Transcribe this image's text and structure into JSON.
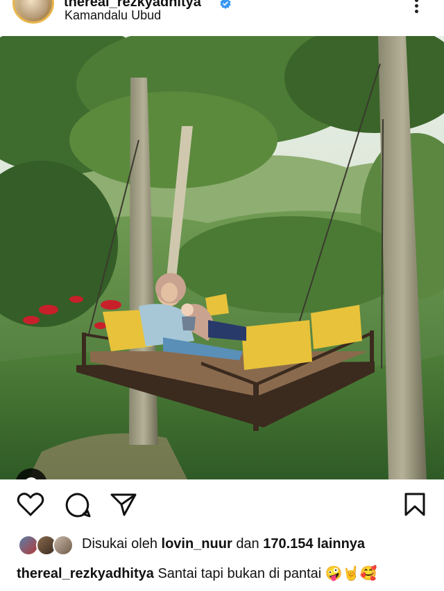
{
  "post": {
    "username": "thereal_rezkyadhitya",
    "location": "Kamandalu Ubud",
    "icons": {
      "verified": "verified-badge-icon",
      "more": "more-options-icon",
      "tag": "tagged-user-icon",
      "like": "heart-icon",
      "comment": "comment-icon",
      "share": "share-icon",
      "save": "bookmark-icon"
    }
  },
  "likes": {
    "prefix": "Disukai oleh",
    "user": "lovin_nuur",
    "connector": "dan",
    "count": "170.154",
    "suffix": "lainnya"
  },
  "caption": {
    "username": "thereal_rezkyadhitya",
    "text": "Santai tapi bukan di pantai",
    "emojis": "🤪🤘🥰"
  },
  "colors": {
    "verified": "#3897f0",
    "story_ring": "#e9b64a",
    "icon": "#111111"
  }
}
